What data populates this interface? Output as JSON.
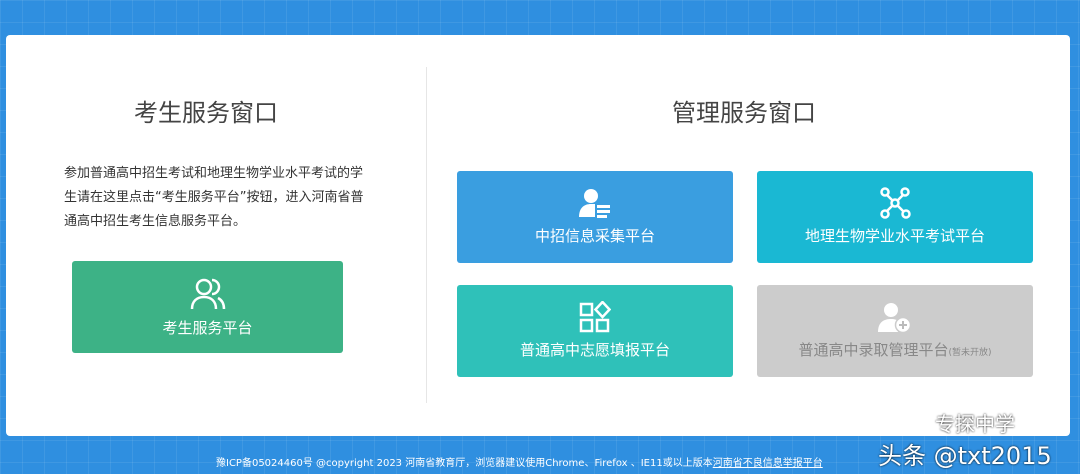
{
  "student": {
    "title": "考生服务窗口",
    "desc": "参加普通高中招生考试和地理生物学业水平考试的学生请在这里点击“考生服务平台”按钮，进入河南省普通高中招生考生信息服务平台。",
    "button": "考生服务平台"
  },
  "admin": {
    "title": "管理服务窗口",
    "buttons": [
      {
        "label": "中招信息采集平台",
        "color": "#3a9ee0"
      },
      {
        "label": "地理生物学业水平考试平台",
        "color": "#1ab8d3"
      },
      {
        "label": "普通高中志愿填报平台",
        "color": "#2fc1b9"
      },
      {
        "label": "普通高中录取管理平台",
        "note": "(暂未开放)",
        "color": "#cccccc"
      }
    ]
  },
  "footer": {
    "text": "豫ICP备05024460号 @copyright 2023 河南省教育厅，浏览器建议使用Chrome、Firefox 、IE11或以上版本",
    "link": "河南省不良信息举报平台"
  },
  "watermark": {
    "top": "专探中学",
    "bottom": "头条 @txt2015"
  }
}
